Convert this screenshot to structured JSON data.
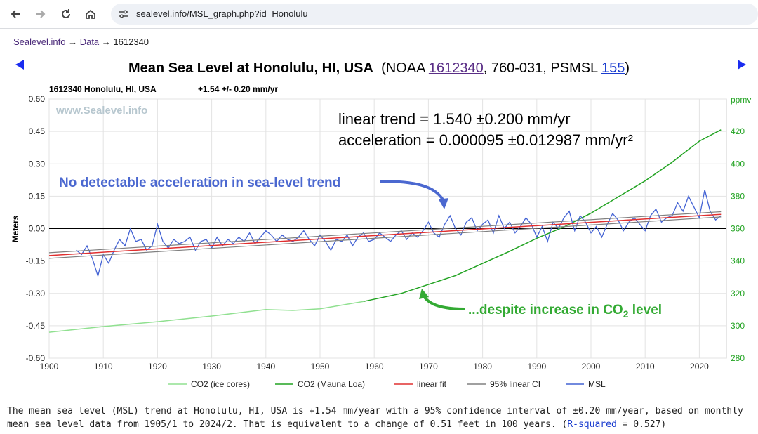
{
  "browser": {
    "url": "sealevel.info/MSL_graph.php?id=Honolulu"
  },
  "breadcrumb": {
    "site": "Sealevel.info",
    "sep1": "→",
    "data": "Data",
    "sep2": "→",
    "station": "1612340"
  },
  "header": {
    "title": "Mean Sea Level at Honolulu, HI, USA",
    "paren_open": "(NOAA ",
    "noaa_id": "1612340",
    "mid": ", 760-031, PSMSL ",
    "psmsl_id": "155",
    "paren_close": ")"
  },
  "chart_data": {
    "type": "line",
    "station_label": "1612340 Honolulu, HI, USA",
    "trend_label": "+1.54 +/- 0.20 mm/yr",
    "watermark": "www.Sealevel.info",
    "trend_text": "linear trend = 1.540 ±0.200 mm/yr",
    "accel_text": "acceleration = 0.000095 ±0.012987 mm/yr²",
    "annotation_blue": "No detectable acceleration in sea-level trend",
    "annotation_green_prefix": "...despite increase in CO",
    "annotation_green_sub": "2",
    "annotation_green_suffix": " level",
    "ylabel_left": "Meters",
    "ylabel_right": "ppmv",
    "xlim": [
      1900,
      2025
    ],
    "ylim_left": [
      -0.6,
      0.6
    ],
    "ylim_right": [
      280,
      440
    ],
    "x_ticks": [
      1900,
      1910,
      1920,
      1930,
      1940,
      1950,
      1960,
      1970,
      1980,
      1990,
      2000,
      2010,
      2020
    ],
    "y_ticks_left": [
      "0.60",
      "0.45",
      "0.30",
      "0.15",
      "0.00",
      "-0.15",
      "-0.30",
      "-0.45",
      "-0.60"
    ],
    "y_ticks_right": [
      280,
      300,
      320,
      340,
      360,
      380,
      400,
      420
    ],
    "legend": [
      "CO2 (ice cores)",
      "CO2 (Mauna Loa)",
      "linear fit",
      "95% linear CI",
      "MSL"
    ],
    "colors": {
      "ice": "#90e090",
      "mauna": "#22a322",
      "fit": "#e03030",
      "ci": "#808080",
      "msl": "#4463d4",
      "annot_blue": "#4b68d0",
      "annot_green": "#33aa33"
    },
    "series": [
      {
        "name": "CO2 (ice cores)",
        "x": [
          1900,
          1910,
          1920,
          1930,
          1940,
          1945,
          1950,
          1958
        ],
        "y": [
          296,
          299.5,
          302.5,
          306,
          310,
          309.5,
          310.5,
          315
        ]
      },
      {
        "name": "CO2 (Mauna Loa)",
        "x": [
          1958,
          1965,
          1970,
          1975,
          1980,
          1985,
          1990,
          1995,
          2000,
          2005,
          2010,
          2015,
          2020,
          2024
        ],
        "y": [
          315,
          320,
          325.5,
          331,
          338.5,
          346,
          354,
          361,
          369.5,
          379.5,
          389.5,
          401,
          414,
          421
        ]
      },
      {
        "name": "linear fit",
        "x": [
          1900,
          2024
        ],
        "y": [
          -0.125,
          0.066
        ]
      },
      {
        "name": "95% linear CI",
        "upper": {
          "x": [
            1900,
            2024
          ],
          "y": [
            -0.112,
            0.078
          ]
        },
        "lower": {
          "x": [
            1900,
            2024
          ],
          "y": [
            -0.138,
            0.054
          ]
        }
      },
      {
        "name": "MSL",
        "x": [
          1905.0,
          1906.0,
          1907.0,
          1908.0,
          1909.0,
          1910.0,
          1911.0,
          1912.0,
          1913.0,
          1914.0,
          1915.0,
          1916.0,
          1917.0,
          1918.0,
          1919.0,
          1920.0,
          1921.0,
          1922.0,
          1923.0,
          1924.0,
          1925.0,
          1926.0,
          1927.0,
          1928.0,
          1929.0,
          1930.0,
          1931.0,
          1932.0,
          1933.0,
          1934.0,
          1935.0,
          1936.0,
          1937.0,
          1938.0,
          1939.0,
          1940.0,
          1941.0,
          1942.0,
          1943.0,
          1944.0,
          1945.0,
          1946.0,
          1947.0,
          1948.0,
          1949.0,
          1950.0,
          1951.0,
          1952.0,
          1953.0,
          1954.0,
          1955.0,
          1956.0,
          1957.0,
          1958.0,
          1959.0,
          1960.0,
          1961.0,
          1962.0,
          1963.0,
          1964.0,
          1965.0,
          1966.0,
          1967.0,
          1968.0,
          1969.0,
          1970.0,
          1971.0,
          1972.0,
          1973.0,
          1974.0,
          1975.0,
          1976.0,
          1977.0,
          1978.0,
          1979.0,
          1980.0,
          1981.0,
          1982.0,
          1983.0,
          1984.0,
          1985.0,
          1986.0,
          1987.0,
          1988.0,
          1989.0,
          1990.0,
          1991.0,
          1992.0,
          1993.0,
          1994.0,
          1995.0,
          1996.0,
          1997.0,
          1998.0,
          1999.0,
          2000.0,
          2001.0,
          2002.0,
          2003.0,
          2004.0,
          2005.0,
          2006.0,
          2007.0,
          2008.0,
          2009.0,
          2010.0,
          2011.0,
          2012.0,
          2013.0,
          2014.0,
          2015.0,
          2016.0,
          2017.0,
          2018.0,
          2019.0,
          2020.0,
          2021.0,
          2022.0,
          2023.0,
          2024.0
        ],
        "y": [
          -0.1,
          -0.12,
          -0.08,
          -0.14,
          -0.22,
          -0.12,
          -0.16,
          -0.1,
          -0.05,
          -0.08,
          0.0,
          -0.06,
          -0.05,
          -0.1,
          -0.08,
          0.02,
          -0.06,
          -0.09,
          -0.05,
          -0.07,
          -0.06,
          -0.04,
          -0.1,
          -0.06,
          -0.05,
          -0.09,
          -0.04,
          -0.08,
          -0.05,
          -0.07,
          -0.04,
          -0.06,
          -0.02,
          -0.07,
          -0.04,
          -0.01,
          -0.03,
          -0.06,
          -0.03,
          -0.05,
          -0.06,
          -0.04,
          -0.01,
          -0.05,
          -0.08,
          -0.03,
          -0.06,
          -0.1,
          -0.05,
          -0.06,
          -0.03,
          -0.08,
          -0.04,
          -0.02,
          -0.06,
          -0.05,
          -0.02,
          -0.04,
          -0.06,
          -0.03,
          -0.01,
          -0.05,
          -0.02,
          -0.04,
          -0.01,
          0.03,
          -0.02,
          -0.04,
          0.02,
          0.06,
          0.0,
          -0.03,
          0.03,
          0.05,
          -0.01,
          0.02,
          0.04,
          -0.02,
          0.06,
          0.0,
          0.03,
          -0.02,
          0.01,
          0.05,
          0.02,
          -0.04,
          0.01,
          -0.06,
          0.03,
          0.0,
          0.05,
          0.08,
          -0.01,
          0.06,
          0.03,
          -0.02,
          0.01,
          -0.04,
          0.02,
          0.07,
          0.04,
          -0.01,
          0.03,
          0.05,
          0.02,
          -0.01,
          0.06,
          0.09,
          0.03,
          0.05,
          0.06,
          0.12,
          0.08,
          0.15,
          0.1,
          0.05,
          0.18,
          0.08,
          0.04,
          0.06
        ]
      }
    ]
  },
  "description": {
    "text1": "The mean sea level (MSL) trend at Honolulu, HI, USA is +1.54 mm/year with a 95% confidence interval of ±0.20 mm/year, based on monthly mean sea level data from 1905/1 to 2024/2. That is equivalent to a change of 0.51 feet in 100 years. (",
    "link": "R-squared",
    "text2": " = 0.527)"
  }
}
